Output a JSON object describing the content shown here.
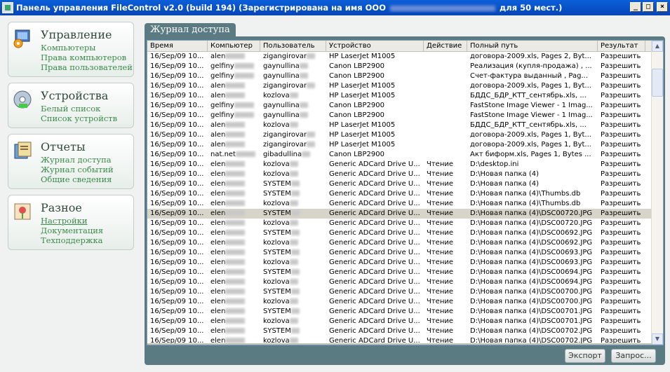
{
  "window": {
    "title_prefix": "Панель управления FileControl v2.0 (build 194) (Зарегистрирована на имя ООО",
    "title_suffix": "для 50 мест.)",
    "minimize": "_",
    "maximize": "□",
    "close": "×"
  },
  "sidebar": {
    "groups": [
      {
        "title": "Управление",
        "icon": "management-icon",
        "links": [
          "Компьютеры",
          "Права компьютеров",
          "Права пользователей"
        ]
      },
      {
        "title": "Устройства",
        "icon": "devices-icon",
        "links": [
          "Белый список",
          "Список устройств"
        ]
      },
      {
        "title": "Отчеты",
        "icon": "reports-icon",
        "links": [
          "Журнал доступа",
          "Журнал событий",
          "Общие сведения"
        ]
      },
      {
        "title": "Разное",
        "icon": "misc-icon",
        "links": [
          "Настройки",
          "Документация",
          "Техподдержка"
        ]
      }
    ]
  },
  "tab": {
    "label": "Журнал доступа"
  },
  "table": {
    "columns": [
      "Время",
      "Компьютер",
      "Пользователь",
      "Устройство",
      "Действие",
      "Полный путь",
      "Результат"
    ],
    "rows": [
      [
        "16/Sep/09 10...",
        "alen",
        "zigangirovar",
        "HP LaserJet M1005",
        "",
        "договора-2009.xls, Pages 2, Byt...",
        "Разрешить"
      ],
      [
        "16/Sep/09 10...",
        "gelfiny",
        "gaynullina",
        "Canon LBP2900",
        "",
        "Реализация (купля-продажа) , ...",
        "Разрешить"
      ],
      [
        "16/Sep/09 10...",
        "gelfiny",
        "gaynullina",
        "Canon LBP2900",
        "",
        "Счет-фактура выданный , Pag...",
        "Разрешить"
      ],
      [
        "16/Sep/09 10...",
        "alen",
        "zigangirovar",
        "HP LaserJet M1005",
        "",
        "договора-2009.xls, Pages 1, Byt...",
        "Разрешить"
      ],
      [
        "16/Sep/09 10...",
        "alen",
        "kozlova",
        "HP LaserJet M1005",
        "",
        "БДДС_БДР_КТТ_сентябрь.xls, ...",
        "Разрешить"
      ],
      [
        "16/Sep/09 10...",
        "gelfiny",
        "gaynullina",
        "Canon LBP2900",
        "",
        "FastStone Image Viewer - 1 Imag...",
        "Разрешить"
      ],
      [
        "16/Sep/09 10...",
        "gelfiny",
        "gaynullina",
        "Canon LBP2900",
        "",
        "FastStone Image Viewer - 1 Imag...",
        "Разрешить"
      ],
      [
        "16/Sep/09 10...",
        "alen",
        "kozlova",
        "HP LaserJet M1005",
        "",
        "БДДС_БДР_КТТ_сентябрь.xls, ...",
        "Разрешить"
      ],
      [
        "16/Sep/09 10...",
        "alen",
        "zigangirovar",
        "HP LaserJet M1005",
        "",
        "договора-2009.xls, Pages 1, Byt...",
        "Разрешить"
      ],
      [
        "16/Sep/09 10...",
        "alen",
        "zigangirovar",
        "HP LaserJet M1005",
        "",
        "договора-2009.xls, Pages 1, Byt...",
        "Разрешить"
      ],
      [
        "16/Sep/09 10...",
        "nat.net",
        "gibadullina",
        "Canon LBP2900",
        "",
        "Акт биформ.xls, Pages 1, Bytes ...",
        "Разрешить"
      ],
      [
        "16/Sep/09 10...",
        "elen",
        "kozlova",
        "Generic ADCard Drive U...",
        "Чтение",
        "D:\\desktop.ini",
        "Разрешить"
      ],
      [
        "16/Sep/09 10...",
        "elen",
        "kozlova",
        "Generic ADCard Drive U...",
        "Чтение",
        "D:\\Новая папка (4)",
        "Разрешить"
      ],
      [
        "16/Sep/09 10...",
        "elen",
        "SYSTEM",
        "Generic ADCard Drive U...",
        "Чтение",
        "D:\\Новая папка (4)",
        "Разрешить"
      ],
      [
        "16/Sep/09 10...",
        "elen",
        "SYSTEM",
        "Generic ADCard Drive U...",
        "Чтение",
        "D:\\Новая папка (4)\\Thumbs.db",
        "Разрешить"
      ],
      [
        "16/Sep/09 10...",
        "elen",
        "kozlova",
        "Generic ADCard Drive U...",
        "Чтение",
        "D:\\Новая папка (4)\\Thumbs.db",
        "Разрешить"
      ],
      [
        "16/Sep/09 10...",
        "elen",
        "SYSTEM",
        "Generic ADCard Drive U...",
        "Чтение",
        "D:\\Новая папка (4)\\DSC00720.JPG",
        "Разрешить"
      ],
      [
        "16/Sep/09 10...",
        "elen",
        "kozlova",
        "Generic ADCard Drive U...",
        "Чтение",
        "D:\\Новая папка (4)\\DSC00720.JPG",
        "Разрешить"
      ],
      [
        "16/Sep/09 10...",
        "elen",
        "SYSTEM",
        "Generic ADCard Drive U...",
        "Чтение",
        "D:\\Новая папка (4)\\DSC00692.JPG",
        "Разрешить"
      ],
      [
        "16/Sep/09 10...",
        "elen",
        "kozlova",
        "Generic ADCard Drive U...",
        "Чтение",
        "D:\\Новая папка (4)\\DSC00692.JPG",
        "Разрешить"
      ],
      [
        "16/Sep/09 10...",
        "elen",
        "SYSTEM",
        "Generic ADCard Drive U...",
        "Чтение",
        "D:\\Новая папка (4)\\DSC00693.JPG",
        "Разрешить"
      ],
      [
        "16/Sep/09 10...",
        "elen",
        "kozlova",
        "Generic ADCard Drive U...",
        "Чтение",
        "D:\\Новая папка (4)\\DSC00693.JPG",
        "Разрешить"
      ],
      [
        "16/Sep/09 10...",
        "elen",
        "SYSTEM",
        "Generic ADCard Drive U...",
        "Чтение",
        "D:\\Новая папка (4)\\DSC00694.JPG",
        "Разрешить"
      ],
      [
        "16/Sep/09 10...",
        "elen",
        "kozlova",
        "Generic ADCard Drive U...",
        "Чтение",
        "D:\\Новая папка (4)\\DSC00694.JPG",
        "Разрешить"
      ],
      [
        "16/Sep/09 10...",
        "elen",
        "SYSTEM",
        "Generic ADCard Drive U...",
        "Чтение",
        "D:\\Новая папка (4)\\DSC00700.JPG",
        "Разрешить"
      ],
      [
        "16/Sep/09 10...",
        "elen",
        "kozlova",
        "Generic ADCard Drive U...",
        "Чтение",
        "D:\\Новая папка (4)\\DSC00700.JPG",
        "Разрешить"
      ],
      [
        "16/Sep/09 10...",
        "elen",
        "SYSTEM",
        "Generic ADCard Drive U...",
        "Чтение",
        "D:\\Новая папка (4)\\DSC00701.JPG",
        "Разрешить"
      ],
      [
        "16/Sep/09 10...",
        "elen",
        "kozlova",
        "Generic ADCard Drive U...",
        "Чтение",
        "D:\\Новая папка (4)\\DSC00701.JPG",
        "Разрешить"
      ],
      [
        "16/Sep/09 10...",
        "elen",
        "SYSTEM",
        "Generic ADCard Drive U...",
        "Чтение",
        "D:\\Новая папка (4)\\DSC00702.JPG",
        "Разрешить"
      ],
      [
        "16/Sep/09 10...",
        "elen",
        "kozlova",
        "Generic ADCard Drive U...",
        "Чтение",
        "D:\\Новая папка (4)\\DSC00702.JPG",
        "Разрешить"
      ]
    ],
    "selected_row": 16
  },
  "buttons": {
    "export": "Экспорт",
    "query": "Запрос..."
  }
}
